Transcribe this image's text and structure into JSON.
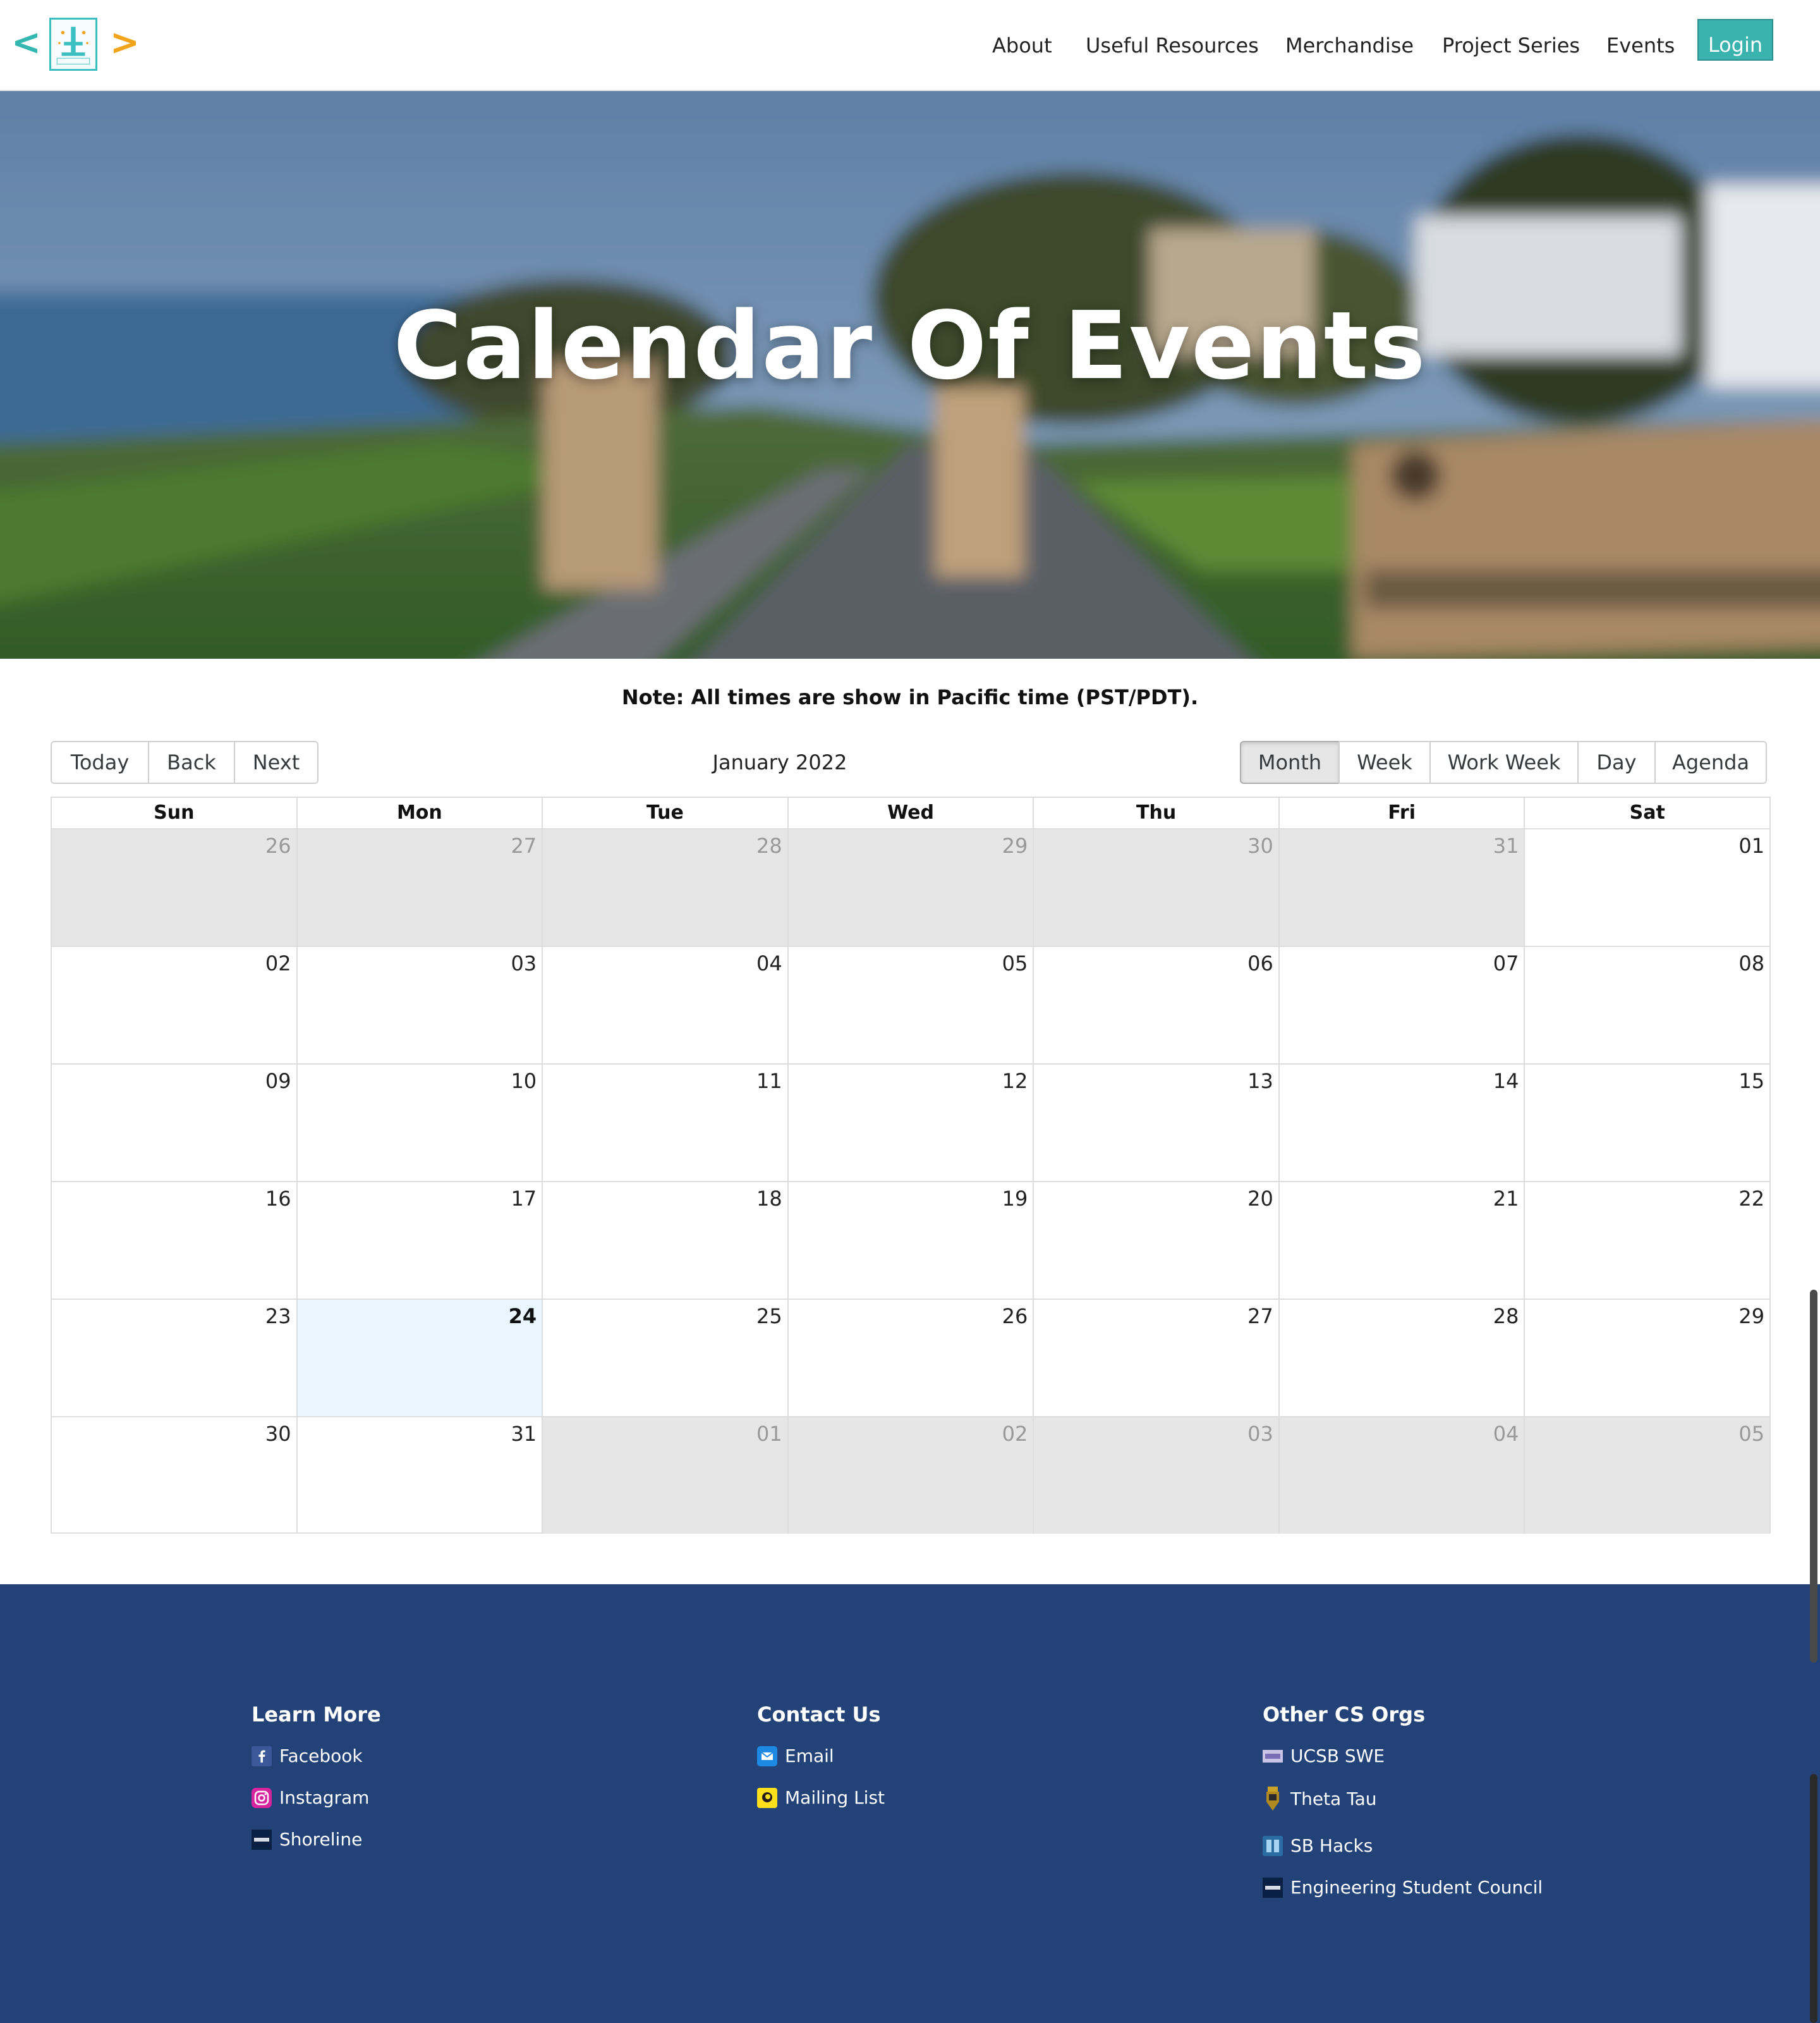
{
  "nav": {
    "brand_left": "<",
    "brand_right": ">",
    "logo_text": "CODERSCO",
    "links": [
      "About",
      "Useful Resources",
      "Merchandise",
      "Project Series",
      "Events"
    ],
    "login_label": "Login",
    "accent_color": "#3ab2ad"
  },
  "hero": {
    "title": "Calendar Of Events"
  },
  "note": "Note: All times are show in Pacific time (PST/PDT).",
  "toolbar": {
    "nav_buttons": [
      "Today",
      "Back",
      "Next"
    ],
    "label": "January 2022",
    "view_buttons": [
      "Month",
      "Week",
      "Work Week",
      "Day",
      "Agenda"
    ],
    "active_view": "Month"
  },
  "calendar": {
    "weekdays": [
      "Sun",
      "Mon",
      "Tue",
      "Wed",
      "Thu",
      "Fri",
      "Sat"
    ],
    "weeks": [
      [
        "26",
        "27",
        "28",
        "29",
        "30",
        "31",
        "01"
      ],
      [
        "02",
        "03",
        "04",
        "05",
        "06",
        "07",
        "08"
      ],
      [
        "09",
        "10",
        "11",
        "12",
        "13",
        "14",
        "15"
      ],
      [
        "16",
        "17",
        "18",
        "19",
        "20",
        "21",
        "22"
      ],
      [
        "23",
        "24",
        "25",
        "26",
        "27",
        "28",
        "29"
      ],
      [
        "30",
        "31",
        "01",
        "02",
        "03",
        "04",
        "05"
      ]
    ],
    "today": "24"
  },
  "footer": {
    "columns": [
      {
        "heading": "Learn More",
        "items": [
          {
            "label": "Facebook",
            "icon": "facebook-icon"
          },
          {
            "label": "Instagram",
            "icon": "instagram-icon"
          },
          {
            "label": "Shoreline",
            "icon": "ucsb-icon"
          }
        ]
      },
      {
        "heading": "Contact Us",
        "items": [
          {
            "label": "Email",
            "icon": "email-icon"
          },
          {
            "label": "Mailing List",
            "icon": "mailchimp-icon"
          }
        ]
      },
      {
        "heading": "Other CS Orgs",
        "items": [
          {
            "label": "UCSB SWE",
            "icon": "swe-icon"
          },
          {
            "label": "Theta Tau",
            "icon": "theta-tau-icon"
          },
          {
            "label": "SB Hacks",
            "icon": "sb-hacks-icon"
          },
          {
            "label": "Engineering Student Council",
            "icon": "ucsb-icon"
          }
        ]
      }
    ],
    "background_color": "#234278"
  }
}
